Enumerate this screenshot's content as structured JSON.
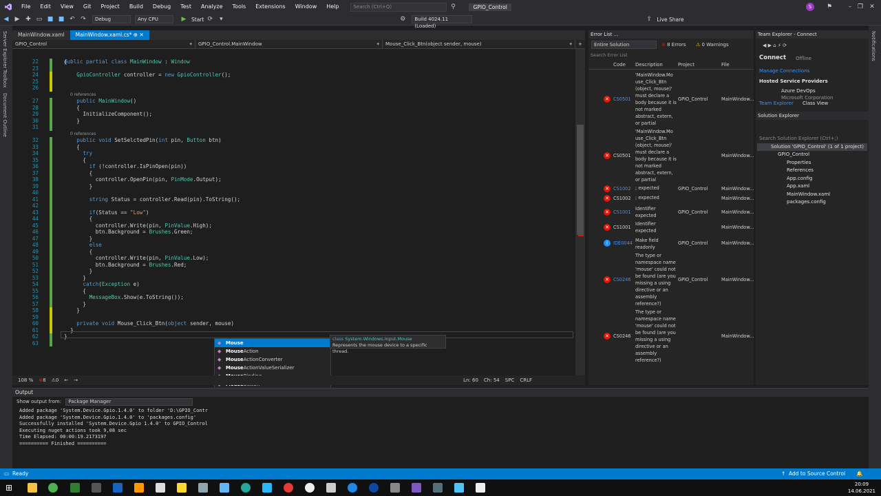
{
  "menu": {
    "items": [
      "File",
      "Edit",
      "View",
      "Git",
      "Project",
      "Build",
      "Debug",
      "Test",
      "Analyze",
      "Tools",
      "Extensions",
      "Window",
      "Help"
    ],
    "search_placeholder": "Search (Ctrl+Q)",
    "solution_name": "GPIO_Control",
    "avatar_letter": "S"
  },
  "toolbar": {
    "config": "Debug",
    "platform": "Any CPU",
    "start_label": "Start",
    "build_info": "Build 4024.11 (Loaded)",
    "live_share": "Live Share"
  },
  "left_strip": {
    "items": [
      "Server Explorer",
      "Toolbox",
      "Document Outline"
    ]
  },
  "right_strip": {
    "items": [
      "Notifications"
    ]
  },
  "tabs": [
    {
      "label": "MainWindow.xaml"
    },
    {
      "label": "MainWindow.xaml.cs*"
    }
  ],
  "nav": {
    "project": "GPIO_Control",
    "class": "GPIO_Control.MainWindow",
    "member": "Mouse_Click_Btn(object sender, mouse)"
  },
  "code_header": "public partial class MainWindow : Window",
  "code_lines": [
    {
      "n": "22",
      "c": "{"
    },
    {
      "n": "23",
      "c": ""
    },
    {
      "n": "24",
      "c": "    GpioController controller = new GpioController();"
    },
    {
      "n": "25",
      "c": ""
    },
    {
      "n": "26",
      "c": ""
    },
    {
      "n": "27",
      "c": "    public MainWindow()"
    },
    {
      "n": "28",
      "c": "    {"
    },
    {
      "n": "29",
      "c": "      InitializeComponent();"
    },
    {
      "n": "30",
      "c": "    }"
    },
    {
      "n": "31",
      "c": ""
    },
    {
      "n": "32",
      "c": "    public void SetSelctedPin(int pin, Button btn)"
    },
    {
      "n": "33",
      "c": "    {"
    },
    {
      "n": "34",
      "c": "      try"
    },
    {
      "n": "35",
      "c": "      {"
    },
    {
      "n": "36",
      "c": "        if (!controller.IsPinOpen(pin))"
    },
    {
      "n": "37",
      "c": "        {"
    },
    {
      "n": "38",
      "c": "          controller.OpenPin(pin, PinMode.Output);"
    },
    {
      "n": "39",
      "c": "        }"
    },
    {
      "n": "40",
      "c": ""
    },
    {
      "n": "41",
      "c": "        string Status = controller.Read(pin).ToString();"
    },
    {
      "n": "42",
      "c": ""
    },
    {
      "n": "43",
      "c": "        if(Status == \"Low\")"
    },
    {
      "n": "44",
      "c": "        {"
    },
    {
      "n": "45",
      "c": "          controller.Write(pin, PinValue.High);"
    },
    {
      "n": "46",
      "c": "          btn.Background = Brushes.Green;"
    },
    {
      "n": "47",
      "c": "        }"
    },
    {
      "n": "48",
      "c": "        else"
    },
    {
      "n": "49",
      "c": "        {"
    },
    {
      "n": "50",
      "c": "          controller.Write(pin, PinValue.Low);"
    },
    {
      "n": "51",
      "c": "          btn.Background = Brushes.Red;"
    },
    {
      "n": "52",
      "c": "        }"
    },
    {
      "n": "53",
      "c": "      }"
    },
    {
      "n": "54",
      "c": "      catch(Exception e)"
    },
    {
      "n": "55",
      "c": "      {"
    },
    {
      "n": "56",
      "c": "        MessageBox.Show(e.ToString());"
    },
    {
      "n": "57",
      "c": "      }"
    },
    {
      "n": "58",
      "c": "    }"
    },
    {
      "n": "59",
      "c": ""
    },
    {
      "n": "60",
      "c": "    private void Mouse_Click_Btn(object sender, mouse)"
    },
    {
      "n": "61",
      "c": "  }"
    },
    {
      "n": "62",
      "c": "}"
    },
    {
      "n": "63",
      "c": ""
    }
  ],
  "refs_label": "0 references",
  "editor_status": {
    "zoom": "108 %",
    "errors": "8",
    "warnings": "0",
    "ln": "Ln: 60",
    "ch": "Ch: 54",
    "spc": "SPC",
    "crlf": "CRLF"
  },
  "autocomplete": {
    "items": [
      "Mouse",
      "MouseAction",
      "MouseActionConverter",
      "MouseActionValueSerializer",
      "MouseBinding",
      "MouseButton",
      "MouseButtonEventArgs",
      "MouseButtonEventHandler",
      "MouseButtonState"
    ],
    "match": "Mouse",
    "tooltip_kind": "class",
    "tooltip_name": "System.Windows.Input.Mouse",
    "tooltip_desc": "Represents the mouse device to a specific thread."
  },
  "output": {
    "title": "Output",
    "show_from_label": "Show output from:",
    "show_from_value": "Package Manager",
    "lines": [
      "Added package 'System.Device.Gpio.1.4.0' to folder 'D:\\GPIO_Contr",
      "Added package 'System.Device.Gpio.1.4.0' to 'packages.config'",
      "Successfully installed 'System.Device.Gpio 1.4.0' to GPIO_Control",
      "Executing nuget actions took 9,08 sec",
      "Time Elapsed: 00:00:19.2173197",
      "========== Finished =========="
    ]
  },
  "error_list": {
    "title": "Error List ...",
    "scope": "Entire Solution",
    "errors_label": "8 Errors",
    "warnings_label": "0 Warnings",
    "search_placeholder": "Search Error List",
    "columns": [
      "Code",
      "Description",
      "Project",
      "File"
    ],
    "rows": [
      {
        "code": "CS0501",
        "desc": "'MainWindow.Mo use_Click_Btn (object, mouse)' must declare a body because it is not marked abstract, extern, or partial",
        "proj": "GPIO_Control",
        "file": "MainWindow...",
        "kind": "error",
        "link": true
      },
      {
        "code": "CS0501",
        "desc": "'MainWindow.Mo use_Click_Btn (object, mouse)' must declare a body because it is not marked abstract, extern, or partial",
        "proj": "",
        "file": "MainWindow...",
        "kind": "error",
        "link": false
      },
      {
        "code": "CS1002",
        "desc": "; expected",
        "proj": "GPIO_Control",
        "file": "MainWindow...",
        "kind": "error",
        "link": true
      },
      {
        "code": "CS1002",
        "desc": "; expected",
        "proj": "",
        "file": "MainWindow...",
        "kind": "error",
        "link": false
      },
      {
        "code": "CS1001",
        "desc": "Identifier expected",
        "proj": "GPIO_Control",
        "file": "MainWindow...",
        "kind": "error",
        "link": true
      },
      {
        "code": "CS1001",
        "desc": "Identifier expected",
        "proj": "",
        "file": "MainWindow...",
        "kind": "error",
        "link": false
      },
      {
        "code": "IDE0044",
        "desc": "Make field readonly",
        "proj": "GPIO_Control",
        "file": "MainWindow...",
        "kind": "info",
        "link": true
      },
      {
        "code": "CS0246",
        "desc": "The type or namespace name 'mouse' could not be found (are you missing a using directive or an assembly reference?)",
        "proj": "GPIO_Control",
        "file": "MainWindow...",
        "kind": "error",
        "link": true
      },
      {
        "code": "CS0246",
        "desc": "The type or namespace name 'mouse' could not be found (are you missing a using directive or an assembly reference?)",
        "proj": "",
        "file": "MainWindow...",
        "kind": "error",
        "link": false
      }
    ]
  },
  "team_explorer": {
    "title": "Team Explorer - Connect",
    "connect": "Connect",
    "offline": "Offline",
    "manage": "Manage Connections",
    "hosted": "Hosted Service Providers",
    "azure": "Azure DevOps",
    "ms_corp": "Microsoft Corporation",
    "tab_team": "Team Explorer",
    "tab_class": "Class View"
  },
  "solution_explorer": {
    "title": "Solution Explorer",
    "search_placeholder": "Search Solution Explorer (Ctrl+;)",
    "items": [
      "Solution 'GPIO_Control' (1 of 1 project)",
      "GPIO_Control",
      "Properties",
      "References",
      "App.config",
      "App.xaml",
      "MainWindow.xaml",
      "packages.config"
    ]
  },
  "statusbar": {
    "ready": "Ready",
    "source_control": "Add to Source Control"
  },
  "clock": {
    "time": "20:09",
    "date": "14.06.2021"
  }
}
